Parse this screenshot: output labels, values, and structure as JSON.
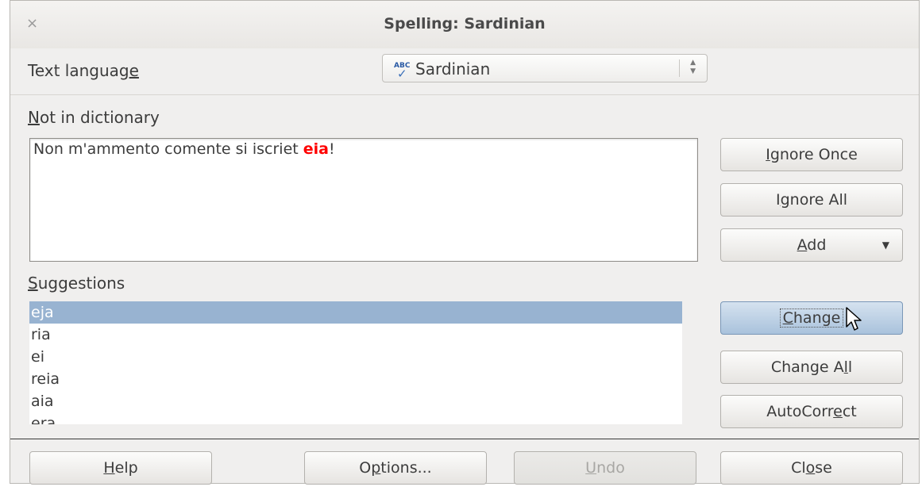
{
  "title": "Spelling: Sardinian",
  "close_glyph": "×",
  "text_language": {
    "label_pre": "Text languag",
    "label_ul": "e",
    "value": "Sardinian",
    "icon": "abc-spellcheck-icon",
    "icon_text": "ABC",
    "icon_check": "✓"
  },
  "not_in_dictionary": {
    "label_ul": "N",
    "label_rest": "ot in dictionary",
    "text_before": "Non m'ammento comente si iscriet ",
    "error_word": "eia",
    "text_after": "!"
  },
  "suggestions": {
    "label_ul": "S",
    "label_rest": "uggestions",
    "items": [
      "eja",
      "ria",
      "ei",
      "reia",
      "aia",
      "era"
    ],
    "selected_index": 0
  },
  "side_buttons": {
    "ignore_once": {
      "pre": "",
      "ul": "I",
      "post": "gnore Once"
    },
    "ignore_all": {
      "pre": "I",
      "ul": "g",
      "post": "nore All"
    },
    "add": {
      "pre": "",
      "ul": "A",
      "post": "dd"
    },
    "change": {
      "pre": "",
      "ul": "C",
      "post": "hange"
    },
    "change_all": {
      "pre": "Change A",
      "ul": "l",
      "post": "l"
    },
    "autocorrect": {
      "pre": "AutoCorr",
      "ul": "e",
      "post": "ct"
    }
  },
  "bottom_buttons": {
    "help": {
      "pre": "",
      "ul": "H",
      "post": "elp"
    },
    "options": {
      "pre": "O",
      "ul": "p",
      "post": "tions..."
    },
    "undo": {
      "pre": "",
      "ul": "U",
      "post": "ndo"
    },
    "close": {
      "pre": "Cl",
      "ul": "o",
      "post": "se"
    }
  },
  "colors": {
    "error": "#ff0000",
    "selection": "#98b3d1",
    "active_button": "#a9c2dc"
  }
}
